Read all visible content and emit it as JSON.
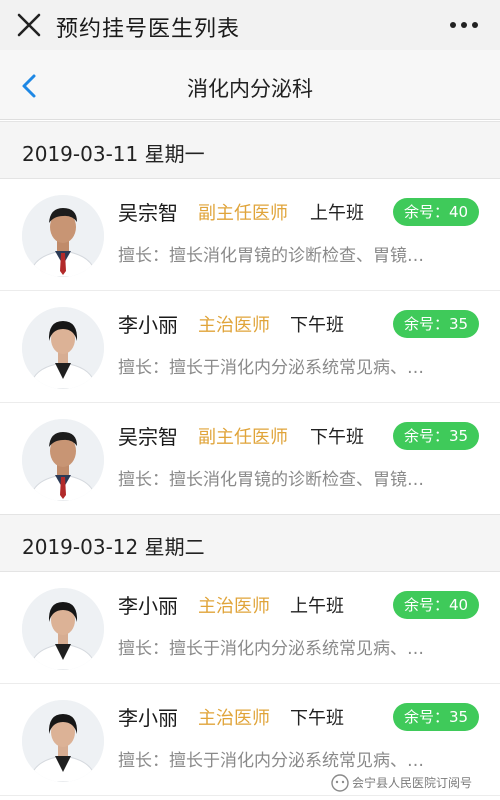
{
  "header": {
    "title": "预约挂号医生列表"
  },
  "nav": {
    "title": "消化内分泌科"
  },
  "dates": [
    {
      "label": "2019-03-11 星期一"
    },
    {
      "label": "2019-03-12 星期二"
    }
  ],
  "doctors": [
    {
      "name": "吴宗智",
      "title": "副主任医师",
      "shift": "上午班",
      "remaining": "余号：40",
      "specialty": "擅长：擅长消化胃镜的诊断检查、胃镜…",
      "avatar": "male-doctor-avatar"
    },
    {
      "name": "李小丽",
      "title": "主治医师",
      "shift": "下午班",
      "remaining": "余号：35",
      "specialty": "擅长：擅长于消化内分泌系统常见病、…",
      "avatar": "female-doctor-avatar"
    },
    {
      "name": "吴宗智",
      "title": "副主任医师",
      "shift": "下午班",
      "remaining": "余号：35",
      "specialty": "擅长：擅长消化胃镜的诊断检查、胃镜…",
      "avatar": "male-doctor-avatar"
    },
    {
      "name": "李小丽",
      "title": "主治医师",
      "shift": "上午班",
      "remaining": "余号：40",
      "specialty": "擅长：擅长于消化内分泌系统常见病、…",
      "avatar": "female-doctor-avatar"
    },
    {
      "name": "李小丽",
      "title": "主治医师",
      "shift": "下午班",
      "remaining": "余号：35",
      "specialty": "擅长：擅长于消化内分泌系统常见病、…",
      "avatar": "female-doctor-avatar"
    }
  ],
  "watermark": {
    "text": "会宁县人民医院订阅号"
  },
  "colors": {
    "accent_blue": "#1e88e5",
    "badge_green": "#3fca5a",
    "title_gold": "#e0a43a",
    "muted_gray": "#8a8a8a"
  }
}
